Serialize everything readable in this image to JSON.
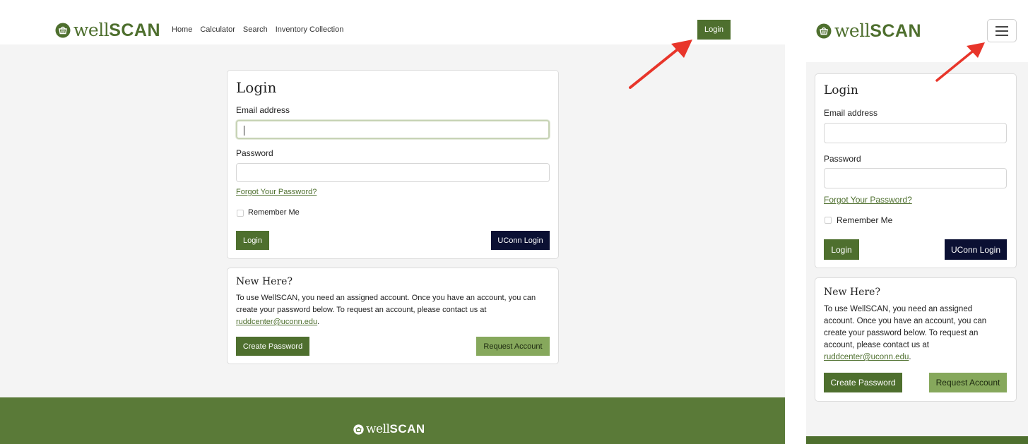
{
  "brand": {
    "name_light": "well",
    "name_bold": "SCAN",
    "color": "#4e6f2e",
    "icon": "basket-icon"
  },
  "nav": {
    "links": [
      "Home",
      "Calculator",
      "Search",
      "Inventory Collection"
    ],
    "login_label": "Login"
  },
  "login_card": {
    "title": "Login",
    "email_label": "Email address",
    "email_value": "",
    "password_label": "Password",
    "password_value": "",
    "forgot_link": "Forgot Your Password?",
    "remember_label": "Remember Me",
    "login_button": "Login",
    "uconn_button": "UConn Login"
  },
  "new_here": {
    "title": "New Here?",
    "text_desktop_1": "To use WellSCAN, you need an assigned account. Once you have an account, you can",
    "text_desktop_2": "create your password below. To request an account, please contact us at",
    "text_m_1": "To use WellSCAN, you need an assigned",
    "text_m_2": "account. Once you have an account, you can",
    "text_m_3": "create your password below. To request an",
    "text_m_4": "account, please contact us at",
    "email": "ruddcenter@uconn.edu",
    "create_button": "Create Password",
    "request_button": "Request Account"
  },
  "colors": {
    "primary": "#4e6f2e",
    "navy": "#0b1033",
    "light_green": "#86a85c",
    "footer": "#5a7a38",
    "annotation": "#e8352a"
  }
}
